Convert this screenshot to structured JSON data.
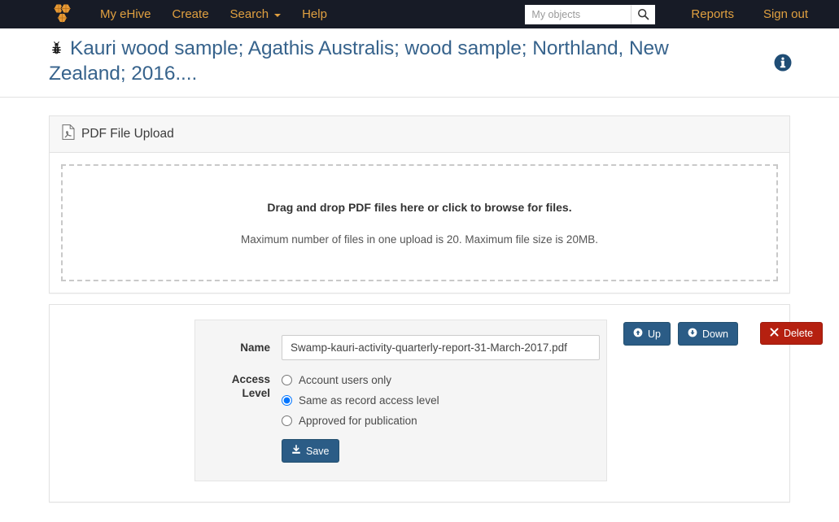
{
  "navbar": {
    "logo_name": "ehive-honeycomb-logo",
    "links": [
      {
        "label": "My eHive",
        "icon": ""
      },
      {
        "label": "Create",
        "icon": ""
      },
      {
        "label": "Search",
        "icon": "chevron-down-icon"
      },
      {
        "label": "Help",
        "icon": ""
      }
    ],
    "search": {
      "placeholder": "My objects",
      "value": "",
      "button_icon": "search-icon"
    },
    "right_links": [
      {
        "label": "Reports"
      },
      {
        "label": "Sign out"
      }
    ],
    "bg_color": "#171b26",
    "link_color": "#e0a040"
  },
  "title_band": {
    "icon": "insect-specimen-icon",
    "title": "Kauri wood sample; Agathis Australis; wood sample; Northland, New Zealand; 2016....",
    "title_color": "#37638c",
    "info_icon": "info-circle-icon"
  },
  "upload_panel": {
    "heading": "PDF File Upload",
    "heading_icon": "pdf-file-icon",
    "dropzone": {
      "primary_text": "Drag and drop PDF files here or click to browse for files.",
      "secondary_text": "Maximum number of files in one upload is 20. Maximum file size is 20MB."
    }
  },
  "file_item": {
    "name_label": "Name",
    "name_value": "Swamp-kauri-activity-quarterly-report-31-March-2017.pdf",
    "access_label_line1": "Access",
    "access_label_line2": "Level",
    "access_options": [
      {
        "label": "Account users only",
        "selected": false
      },
      {
        "label": "Same as record access level",
        "selected": true
      },
      {
        "label": "Approved for publication",
        "selected": false
      }
    ],
    "save_button": {
      "label": "Save",
      "icon": "save-download-icon",
      "color": "#2b5c86"
    },
    "up_button": {
      "label": "Up",
      "icon": "arrow-circle-up-icon",
      "color": "#2b5c86"
    },
    "down_button": {
      "label": "Down",
      "icon": "arrow-circle-down-icon",
      "color": "#2b5c86"
    },
    "delete_button": {
      "label": "Delete",
      "icon": "times-icon",
      "color": "#b52010"
    }
  }
}
